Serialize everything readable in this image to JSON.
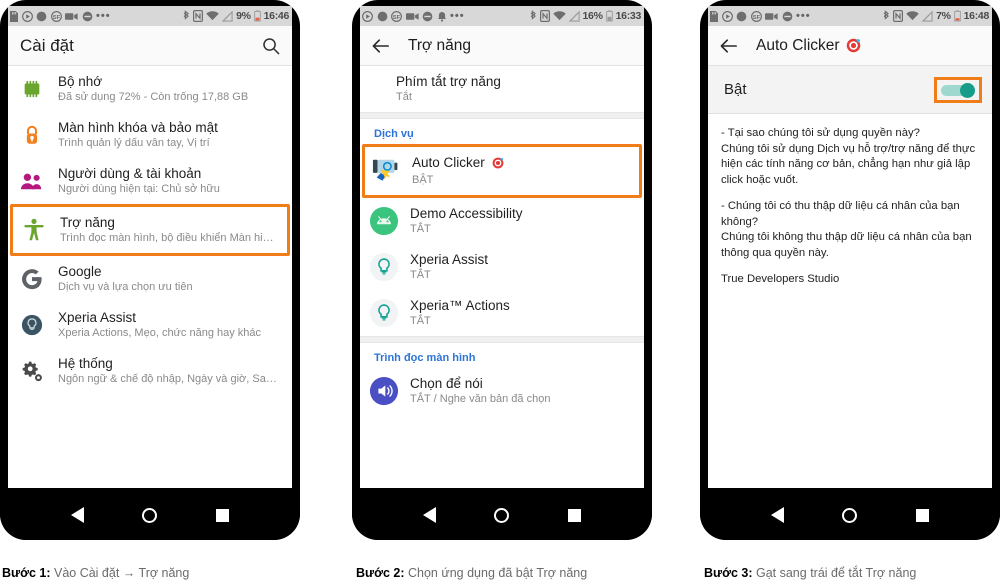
{
  "phones": [
    {
      "status": {
        "battery": "9%",
        "time": "16:46",
        "icons": [
          "sdcard-icon",
          "play-circle-icon",
          "record-dot-icon",
          "sf-app-icon",
          "video-camera-icon",
          "do-not-disturb-icon",
          "more-dots-icon",
          "bluetooth-icon",
          "nfc-icon",
          "wifi-icon",
          "signal-off-icon",
          "battery-icon"
        ]
      },
      "appbar": {
        "title": "Cài đặt",
        "has_back": false,
        "has_search": true
      },
      "rows": [
        {
          "title": "Bộ nhớ",
          "subtitle": "Đã sử dụng 72% - Còn trống 17,88 GB",
          "icon": "memory-chip-icon",
          "highlighted": false
        },
        {
          "title": "Màn hình khóa và bảo mật",
          "subtitle": "Trình quản lý dấu vân tay, Vị trí",
          "icon": "lock-icon",
          "highlighted": false
        },
        {
          "title": "Người dùng & tài khoản",
          "subtitle": "Người dùng hiện tại: Chủ sở hữu",
          "icon": "users-icon",
          "highlighted": false
        },
        {
          "title": "Trợ năng",
          "subtitle": "Trình đọc màn hình, bộ điều khiển Màn hin...",
          "icon": "accessibility-icon",
          "highlighted": true
        },
        {
          "title": "Google",
          "subtitle": "Dịch vụ và lựa chọn ưu tiên",
          "icon": "google-g-icon",
          "highlighted": false
        },
        {
          "title": "Xperia Assist",
          "subtitle": "Xperia Actions, Mẹo, chức năng hay khác",
          "icon": "lightbulb-dark-icon",
          "highlighted": false
        },
        {
          "title": "Hệ thống",
          "subtitle": "Ngôn ngữ & chế độ nhập, Ngày và giờ, Sao...",
          "icon": "settings-gear-icon",
          "highlighted": false
        }
      ]
    },
    {
      "status": {
        "battery": "16%",
        "time": "16:33"
      },
      "appbar": {
        "title": "Trợ năng",
        "has_back": true,
        "has_search": false
      },
      "top_row": {
        "title": "Phím tắt trợ năng",
        "subtitle": "Tắt"
      },
      "section_services": "Dịch vụ",
      "services": [
        {
          "title": "Auto Clicker",
          "subtitle": "BẬT",
          "icon": "auto-clicker-app-icon",
          "highlighted": true,
          "badge": "target-icon"
        },
        {
          "title": "Demo Accessibility",
          "subtitle": "TẮT",
          "icon": "android-green-icon",
          "highlighted": false
        },
        {
          "title": "Xperia Assist",
          "subtitle": "TẮT",
          "icon": "lightbulb-teal-icon",
          "highlighted": false
        },
        {
          "title": "Xperia™ Actions",
          "subtitle": "TẮT",
          "icon": "lightbulb-teal-icon",
          "highlighted": false
        }
      ],
      "section_screenreader": "Trình đọc màn hình",
      "screenreader": [
        {
          "title": "Chọn để nói",
          "subtitle": "TẮT / Nghe văn bản đã chọn",
          "icon": "speaker-blue-icon",
          "highlighted": false
        }
      ]
    },
    {
      "status": {
        "battery": "7%",
        "time": "16:48"
      },
      "appbar": {
        "title": "Auto Clicker",
        "has_back": true,
        "has_search": false,
        "badge": "target-icon"
      },
      "toggle": {
        "label": "Bật",
        "state": "on"
      },
      "description": [
        "- Tại sao chúng tôi sử dụng quyền này?\nChúng tôi sử dụng Dịch vụ hỗ trợ/trợ năng để thực hiện các tính năng cơ bản, chẳng hạn như giả lập click hoặc vuốt.",
        "- Chúng tôi có thu thập dữ liệu cá nhân của bạn không?\nChúng tôi không thu thập dữ liệu cá nhân của bạn thông qua quyền này.",
        "True Developers Studio"
      ]
    }
  ],
  "navbar": {
    "back": "nav-back-icon",
    "home": "nav-home-icon",
    "recents": "nav-recents-icon"
  },
  "captions": [
    {
      "step": "Bước 1:",
      "text": " Vào Cài đặt → Trợ năng"
    },
    {
      "step": "Bước 2:",
      "text": " Chọn ứng dụng đã bật Trợ năng"
    },
    {
      "step": "Bước 3:",
      "text": " Gạt sang trái để tắt Trợ năng"
    }
  ],
  "colors": {
    "highlight": "#f07d18",
    "accent_blue": "#2a74d8",
    "toggle_on": "#159d8a"
  }
}
